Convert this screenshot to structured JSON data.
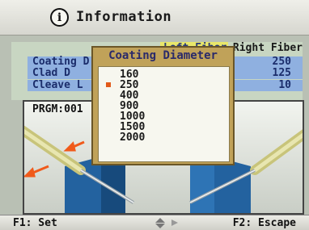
{
  "header": {
    "title": "Information",
    "icon": "info-icon"
  },
  "table": {
    "col_left": "Left Fiber",
    "col_right": "Right Fiber",
    "rows": [
      {
        "label": "Coating D",
        "value": "250"
      },
      {
        "label": "Clad    D",
        "value": "125"
      },
      {
        "label": "Cleave  L",
        "value": "10"
      }
    ]
  },
  "program": {
    "label": "PRGM:001"
  },
  "dialog": {
    "title": "Coating Diameter",
    "options": [
      "160",
      "250",
      "400",
      "900",
      "1000",
      "1500",
      "2000"
    ],
    "selected": "250"
  },
  "footer": {
    "f1": "F1: Set",
    "f2": "F2: Escape",
    "nav_icon": "nav-arrows-icon"
  },
  "colors": {
    "dialog_bg": "#c0a259",
    "row_bg": "#8fb0e0",
    "header_highlight": "#e9e76a",
    "selection_mark": "#e25a1a",
    "block": "#1c5a9a"
  }
}
